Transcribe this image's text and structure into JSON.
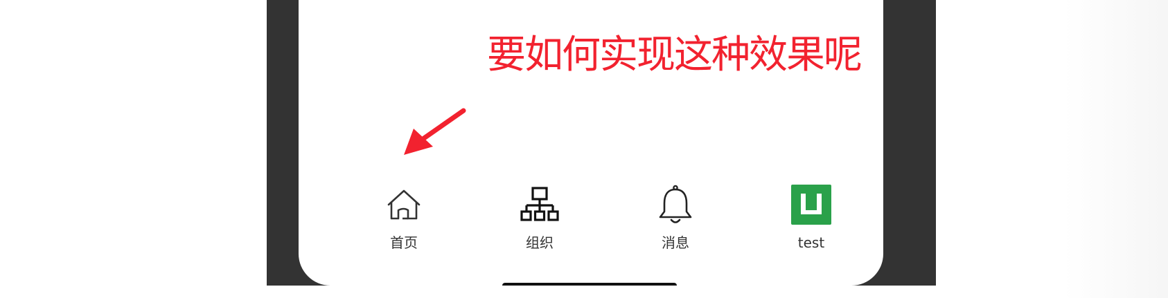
{
  "annotation": {
    "text": "要如何实现这种效果呢",
    "color": "#f2222f"
  },
  "tabs": [
    {
      "label": "首页",
      "icon": "home-icon"
    },
    {
      "label": "组织",
      "icon": "org-chart-icon"
    },
    {
      "label": "消息",
      "icon": "bell-icon"
    },
    {
      "label": "test",
      "icon": "app-logo-icon",
      "icon_color": "#2aa14a"
    }
  ],
  "colors": {
    "frame": "#333333",
    "screen": "#ffffff",
    "tab_label": "#333333"
  }
}
